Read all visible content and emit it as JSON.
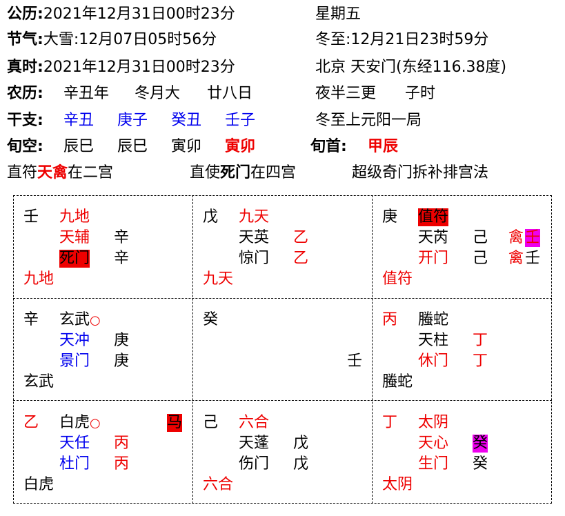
{
  "header": {
    "gongli_label": "公历:",
    "gongli_value": "2021年12月31日00时23分",
    "weekday": "星期五",
    "jieqi_label": "节气:",
    "jieqi_1": "大雪:12月07日05时56分",
    "jieqi_2": "冬至:12月21日23时59分",
    "zhenshi_label": "真时:",
    "zhenshi_value": "2021年12月31日00时23分",
    "location": "北京 天安门(东经116.38度)",
    "nongli_label": "农历:",
    "nongli_year": "辛丑年",
    "nongli_month": "冬月大",
    "nongli_day": "廿八日",
    "shichen_desc": "夜半三更",
    "shichen": "子时",
    "ganzhi_label": "干支:",
    "ganzhi": [
      "辛丑",
      "庚子",
      "癸丑",
      "壬子"
    ],
    "ju": "冬至上元阳一局",
    "xunkong_label": "旬空:",
    "xunkong": [
      "辰巳",
      "辰巳",
      "寅卯",
      "寅卯"
    ],
    "xunshou_label": "旬首:",
    "xunshou": "甲辰",
    "zhifu_pre": "直符",
    "zhifu_star": "天禽",
    "zhifu_post": "在二宫",
    "zhishi_pre": "直使",
    "zhishi_door": "死门",
    "zhishi_post": "在四宫",
    "method": "超级奇门拆补排宫法"
  },
  "palaces": {
    "p4": {
      "stem": "壬",
      "god": "九地",
      "star": "天辅",
      "star_stem": "辛",
      "door": "死门",
      "door_stem": "辛",
      "bottom": "九地"
    },
    "p9": {
      "stem": "戊",
      "god": "九天",
      "star": "天英",
      "star_stem": "乙",
      "door": "惊门",
      "door_stem": "乙",
      "bottom": "九天"
    },
    "p2": {
      "stem": "庚",
      "god": "值符",
      "star": "天芮",
      "star_stem": "己",
      "star_stem2": "禽",
      "star_stem3": "壬",
      "door": "开门",
      "door_stem": "己",
      "door_stem2": "禽",
      "door_stem3": "壬",
      "bottom": "值符"
    },
    "p3": {
      "stem": "辛",
      "god": "玄武",
      "star": "天冲",
      "star_stem": "庚",
      "door": "景门",
      "door_stem": "庚",
      "bottom": "玄武"
    },
    "p5": {
      "stem": "癸",
      "mid": "壬"
    },
    "p7": {
      "stem": "丙",
      "god": "螣蛇",
      "star": "天柱",
      "star_stem": "丁",
      "door": "休门",
      "door_stem": "丁",
      "bottom": "螣蛇"
    },
    "p8": {
      "stem": "乙",
      "god": "白虎",
      "horse": "马",
      "star": "天任",
      "star_stem": "丙",
      "door": "杜门",
      "door_stem": "丙",
      "bottom": "白虎"
    },
    "p1": {
      "stem": "己",
      "god": "六合",
      "star": "天蓬",
      "star_stem": "戊",
      "door": "伤门",
      "door_stem": "戊",
      "bottom": "六合"
    },
    "p6": {
      "stem": "丁",
      "god": "太阴",
      "star": "天心",
      "star_stem": "癸",
      "door": "生门",
      "door_stem": "癸",
      "bottom": "太阴"
    }
  },
  "marks": {
    "empty_circle": "○"
  },
  "colors": {
    "red": "#ee0000",
    "blue": "#0000ee",
    "magenta": "#ee00ee"
  }
}
